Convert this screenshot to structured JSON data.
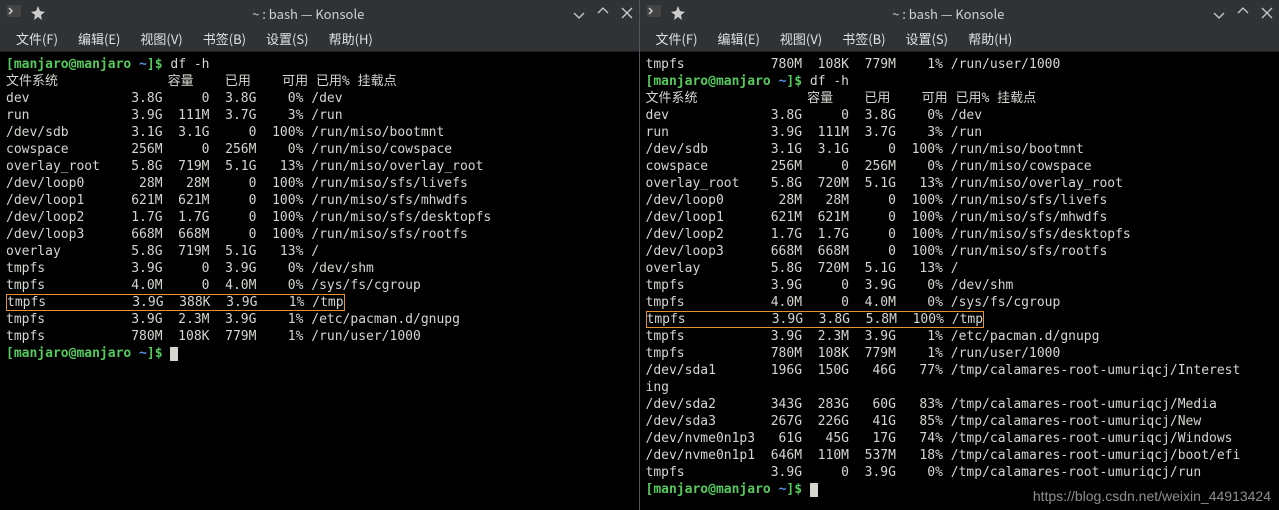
{
  "titlebar_title": "~ : bash — Konsole",
  "menu": {
    "file": "文件(F)",
    "edit": "编辑(E)",
    "view": "视图(V)",
    "bookmark": "书签(B)",
    "settings": "设置(S)",
    "help": "帮助(H)"
  },
  "left": {
    "prompt_user": "manjaro@manjaro",
    "prompt_path": "~",
    "prompt_tail": "]$",
    "cmd": "df -h",
    "hdr": {
      "fs": "文件系统",
      "size": "容量",
      "used": "已用",
      "avail": "可用",
      "usep": "已用%",
      "mount": "挂载点"
    },
    "rows": [
      {
        "fs": "dev",
        "size": "3.8G",
        "used": "0",
        "avail": "3.8G",
        "usep": "0%",
        "mount": "/dev"
      },
      {
        "fs": "run",
        "size": "3.9G",
        "used": "111M",
        "avail": "3.7G",
        "usep": "3%",
        "mount": "/run"
      },
      {
        "fs": "/dev/sdb",
        "size": "3.1G",
        "used": "3.1G",
        "avail": "0",
        "usep": "100%",
        "mount": "/run/miso/bootmnt"
      },
      {
        "fs": "cowspace",
        "size": "256M",
        "used": "0",
        "avail": "256M",
        "usep": "0%",
        "mount": "/run/miso/cowspace"
      },
      {
        "fs": "overlay_root",
        "size": "5.8G",
        "used": "719M",
        "avail": "5.1G",
        "usep": "13%",
        "mount": "/run/miso/overlay_root"
      },
      {
        "fs": "/dev/loop0",
        "size": "28M",
        "used": "28M",
        "avail": "0",
        "usep": "100%",
        "mount": "/run/miso/sfs/livefs"
      },
      {
        "fs": "/dev/loop1",
        "size": "621M",
        "used": "621M",
        "avail": "0",
        "usep": "100%",
        "mount": "/run/miso/sfs/mhwdfs"
      },
      {
        "fs": "/dev/loop2",
        "size": "1.7G",
        "used": "1.7G",
        "avail": "0",
        "usep": "100%",
        "mount": "/run/miso/sfs/desktopfs"
      },
      {
        "fs": "/dev/loop3",
        "size": "668M",
        "used": "668M",
        "avail": "0",
        "usep": "100%",
        "mount": "/run/miso/sfs/rootfs"
      },
      {
        "fs": "overlay",
        "size": "5.8G",
        "used": "719M",
        "avail": "5.1G",
        "usep": "13%",
        "mount": "/"
      },
      {
        "fs": "tmpfs",
        "size": "3.9G",
        "used": "0",
        "avail": "3.9G",
        "usep": "0%",
        "mount": "/dev/shm"
      },
      {
        "fs": "tmpfs",
        "size": "4.0M",
        "used": "0",
        "avail": "4.0M",
        "usep": "0%",
        "mount": "/sys/fs/cgroup"
      },
      {
        "fs": "tmpfs",
        "size": "3.9G",
        "used": "388K",
        "avail": "3.9G",
        "usep": "1%",
        "mount": "/tmp",
        "hl": true
      },
      {
        "fs": "tmpfs",
        "size": "3.9G",
        "used": "2.3M",
        "avail": "3.9G",
        "usep": "1%",
        "mount": "/etc/pacman.d/gnupg"
      },
      {
        "fs": "tmpfs",
        "size": "780M",
        "used": "108K",
        "avail": "779M",
        "usep": "1%",
        "mount": "/run/user/1000"
      }
    ]
  },
  "right": {
    "pre": {
      "fs": "tmpfs",
      "size": "780M",
      "used": "108K",
      "avail": "779M",
      "usep": "1%",
      "mount": "/run/user/1000"
    },
    "prompt_user": "manjaro@manjaro",
    "prompt_path": "~",
    "prompt_tail": "]$",
    "cmd": "df -h",
    "hdr": {
      "fs": "文件系统",
      "size": "容量",
      "used": "已用",
      "avail": "可用",
      "usep": "已用%",
      "mount": "挂载点"
    },
    "rows": [
      {
        "fs": "dev",
        "size": "3.8G",
        "used": "0",
        "avail": "3.8G",
        "usep": "0%",
        "mount": "/dev"
      },
      {
        "fs": "run",
        "size": "3.9G",
        "used": "111M",
        "avail": "3.7G",
        "usep": "3%",
        "mount": "/run"
      },
      {
        "fs": "/dev/sdb",
        "size": "3.1G",
        "used": "3.1G",
        "avail": "0",
        "usep": "100%",
        "mount": "/run/miso/bootmnt"
      },
      {
        "fs": "cowspace",
        "size": "256M",
        "used": "0",
        "avail": "256M",
        "usep": "0%",
        "mount": "/run/miso/cowspace"
      },
      {
        "fs": "overlay_root",
        "size": "5.8G",
        "used": "720M",
        "avail": "5.1G",
        "usep": "13%",
        "mount": "/run/miso/overlay_root"
      },
      {
        "fs": "/dev/loop0",
        "size": "28M",
        "used": "28M",
        "avail": "0",
        "usep": "100%",
        "mount": "/run/miso/sfs/livefs"
      },
      {
        "fs": "/dev/loop1",
        "size": "621M",
        "used": "621M",
        "avail": "0",
        "usep": "100%",
        "mount": "/run/miso/sfs/mhwdfs"
      },
      {
        "fs": "/dev/loop2",
        "size": "1.7G",
        "used": "1.7G",
        "avail": "0",
        "usep": "100%",
        "mount": "/run/miso/sfs/desktopfs"
      },
      {
        "fs": "/dev/loop3",
        "size": "668M",
        "used": "668M",
        "avail": "0",
        "usep": "100%",
        "mount": "/run/miso/sfs/rootfs"
      },
      {
        "fs": "overlay",
        "size": "5.8G",
        "used": "720M",
        "avail": "5.1G",
        "usep": "13%",
        "mount": "/"
      },
      {
        "fs": "tmpfs",
        "size": "3.9G",
        "used": "0",
        "avail": "3.9G",
        "usep": "0%",
        "mount": "/dev/shm"
      },
      {
        "fs": "tmpfs",
        "size": "4.0M",
        "used": "0",
        "avail": "4.0M",
        "usep": "0%",
        "mount": "/sys/fs/cgroup"
      },
      {
        "fs": "tmpfs",
        "size": "3.9G",
        "used": "3.8G",
        "avail": "5.8M",
        "usep": "100%",
        "mount": "/tmp",
        "hl": true
      },
      {
        "fs": "tmpfs",
        "size": "3.9G",
        "used": "2.3M",
        "avail": "3.9G",
        "usep": "1%",
        "mount": "/etc/pacman.d/gnupg"
      },
      {
        "fs": "tmpfs",
        "size": "780M",
        "used": "108K",
        "avail": "779M",
        "usep": "1%",
        "mount": "/run/user/1000"
      },
      {
        "fs": "/dev/sda1",
        "size": "196G",
        "used": "150G",
        "avail": "46G",
        "usep": "77%",
        "mount": "/tmp/calamares-root-umuriqcj/Interest",
        "wrap": "ing"
      },
      {
        "fs": "/dev/sda2",
        "size": "343G",
        "used": "283G",
        "avail": "60G",
        "usep": "83%",
        "mount": "/tmp/calamares-root-umuriqcj/Media"
      },
      {
        "fs": "/dev/sda3",
        "size": "267G",
        "used": "226G",
        "avail": "41G",
        "usep": "85%",
        "mount": "/tmp/calamares-root-umuriqcj/New"
      },
      {
        "fs": "/dev/nvme0n1p3",
        "size": "61G",
        "used": "45G",
        "avail": "17G",
        "usep": "74%",
        "mount": "/tmp/calamares-root-umuriqcj/Windows"
      },
      {
        "fs": "/dev/nvme0n1p1",
        "size": "646M",
        "used": "110M",
        "avail": "537M",
        "usep": "18%",
        "mount": "/tmp/calamares-root-umuriqcj/boot/efi"
      },
      {
        "fs": "tmpfs",
        "size": "3.9G",
        "used": "0",
        "avail": "3.9G",
        "usep": "0%",
        "mount": "/tmp/calamares-root-umuriqcj/run"
      }
    ]
  },
  "watermark": "https://blog.csdn.net/weixin_44913424"
}
